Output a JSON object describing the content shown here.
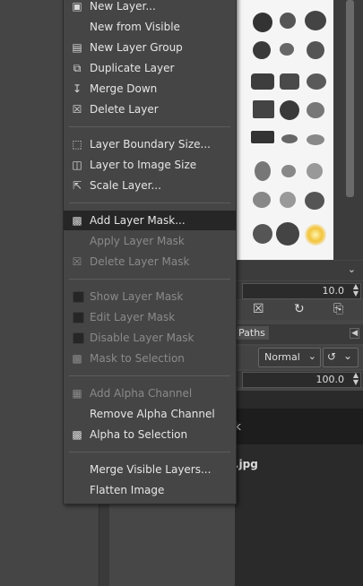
{
  "context_menu": {
    "items": [
      {
        "label": "New Layer...",
        "icon": "new-layer-icon",
        "enabled": true
      },
      {
        "label": "New from Visible",
        "icon": "",
        "enabled": true
      },
      {
        "label": "New Layer Group",
        "icon": "layer-group-icon",
        "enabled": true
      },
      {
        "label": "Duplicate Layer",
        "icon": "duplicate-icon",
        "enabled": true
      },
      {
        "label": "Merge Down",
        "icon": "merge-down-icon",
        "enabled": true
      },
      {
        "label": "Delete Layer",
        "icon": "delete-icon",
        "enabled": true
      },
      {
        "label": "Layer Boundary Size...",
        "icon": "boundary-size-icon",
        "enabled": true
      },
      {
        "label": "Layer to Image Size",
        "icon": "to-image-size-icon",
        "enabled": true
      },
      {
        "label": "Scale Layer...",
        "icon": "scale-icon",
        "enabled": true
      },
      {
        "label": "Add Layer Mask...",
        "icon": "add-mask-icon",
        "enabled": true,
        "highlighted": true
      },
      {
        "label": "Apply Layer Mask",
        "icon": "",
        "enabled": false
      },
      {
        "label": "Delete Layer Mask",
        "icon": "delete-mask-icon",
        "enabled": false
      },
      {
        "label": "Show Layer Mask",
        "icon": "checkbox",
        "enabled": false
      },
      {
        "label": "Edit Layer Mask",
        "icon": "checkbox",
        "enabled": false
      },
      {
        "label": "Disable Layer Mask",
        "icon": "checkbox",
        "enabled": false
      },
      {
        "label": "Mask to Selection",
        "icon": "mask-selection-icon",
        "enabled": false
      },
      {
        "label": "Add Alpha Channel",
        "icon": "alpha-channel-icon",
        "enabled": false
      },
      {
        "label": "Remove Alpha Channel",
        "icon": "",
        "enabled": true
      },
      {
        "label": "Alpha to Selection",
        "icon": "alpha-selection-icon",
        "enabled": true
      },
      {
        "label": "Merge Visible Layers...",
        "icon": "",
        "enabled": true
      },
      {
        "label": "Flatten Image",
        "icon": "",
        "enabled": true
      }
    ]
  },
  "dock": {
    "spacing_value": "10.0",
    "tab_paths": "Paths",
    "mode": "Normal",
    "opacity": "100.0",
    "layer_name_partial": "k",
    "image_name_partial": ".jpg"
  },
  "colors": {
    "menu_bg": "#454545",
    "highlight": "#262626",
    "disabled_text": "#8a8a8a"
  }
}
